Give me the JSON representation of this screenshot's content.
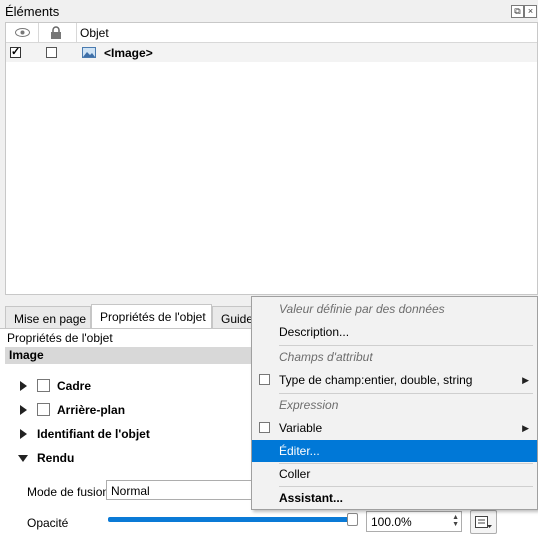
{
  "dock": {
    "title": "Éléments",
    "columns": {
      "object": "Objet"
    },
    "rows": [
      {
        "label": "<Image>",
        "visible": true,
        "locked": false
      }
    ]
  },
  "tabs": [
    {
      "label": "Mise en page",
      "active": false
    },
    {
      "label": "Propriétés de l'objet",
      "active": true
    },
    {
      "label": "Guides",
      "active": false
    }
  ],
  "panel": {
    "title": "Propriétés de l'objet",
    "section": "Image",
    "groups": [
      "Cadre",
      "Arrière-plan",
      "Identifiant de l'objet",
      "Rendu"
    ],
    "blend_label": "Mode de fusion",
    "blend_value": "Normal",
    "opacity_label": "Opacité",
    "opacity_value": "100.0%",
    "opacity_fraction": 1.0
  },
  "menu": {
    "items": [
      {
        "label": "Valeur définie par des données",
        "kind": "header"
      },
      {
        "label": "Description...",
        "kind": "item"
      },
      {
        "label": "Champs d'attribut",
        "kind": "header"
      },
      {
        "label": "Type de champ:entier, double, string",
        "kind": "check-sub"
      },
      {
        "label": "Expression",
        "kind": "header"
      },
      {
        "label": "Variable",
        "kind": "check-sub"
      },
      {
        "label": "Éditer...",
        "kind": "highlighted"
      },
      {
        "label": "Coller",
        "kind": "item"
      },
      {
        "label": "Assistant...",
        "kind": "bold"
      }
    ]
  },
  "colors": {
    "accent": "#0078d7",
    "slider": "#0a7ad6"
  }
}
